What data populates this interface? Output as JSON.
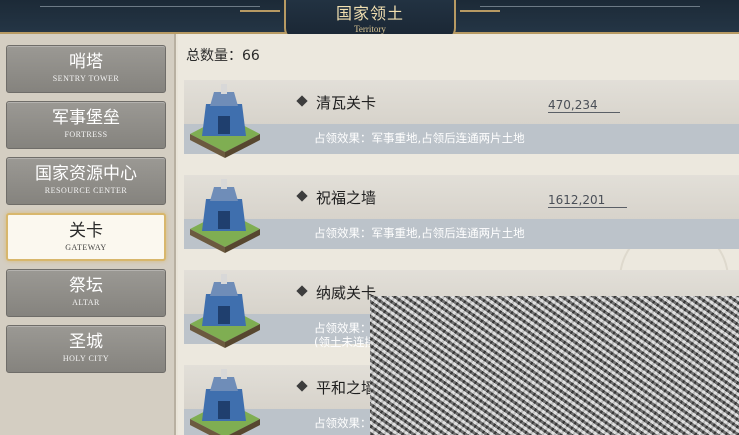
{
  "header": {
    "title_cn": "国家领土",
    "title_en": "Territory"
  },
  "sidebar": {
    "items": [
      {
        "label": "哨塔",
        "sub": "SENTRY TOWER",
        "active": false
      },
      {
        "label": "军事堡垒",
        "sub": "FORTRESS",
        "active": false
      },
      {
        "label": "国家资源中心",
        "sub": "RESOURCE CENTER",
        "active": false
      },
      {
        "label": "关卡",
        "sub": "GATEWAY",
        "active": true
      },
      {
        "label": "祭坛",
        "sub": "ALTAR",
        "active": false
      },
      {
        "label": "圣城",
        "sub": "HOLY CITY",
        "active": false
      }
    ]
  },
  "main": {
    "total_label": "总数量：66",
    "cards": [
      {
        "name": "清瓦关卡",
        "coord": "470,234",
        "effect": "占领效果：军事重地,占领后连通两片土地",
        "effect2": ""
      },
      {
        "name": "祝福之墙",
        "coord": "1612,201",
        "effect": "占领效果：军事重地,占领后连通两片土地",
        "effect2": ""
      },
      {
        "name": "纳威关卡",
        "coord": "",
        "effect": "占领效果：军事重地",
        "effect2": "(领土未连接)"
      },
      {
        "name": "平和之墙",
        "coord": "",
        "effect": "占领效果：军事重地,占领后连通两片土地",
        "effect2": ""
      }
    ]
  },
  "colors": {
    "header_bg": "#1c2a37",
    "gold_trim": "#b79a63",
    "tab_bg": "#8f8d88",
    "tab_active_bg": "#fbf8ef",
    "card_band": "#bcc3ca"
  },
  "icons": {
    "building": "gateway-building-icon",
    "bullet": "diamond-bullet-icon"
  }
}
